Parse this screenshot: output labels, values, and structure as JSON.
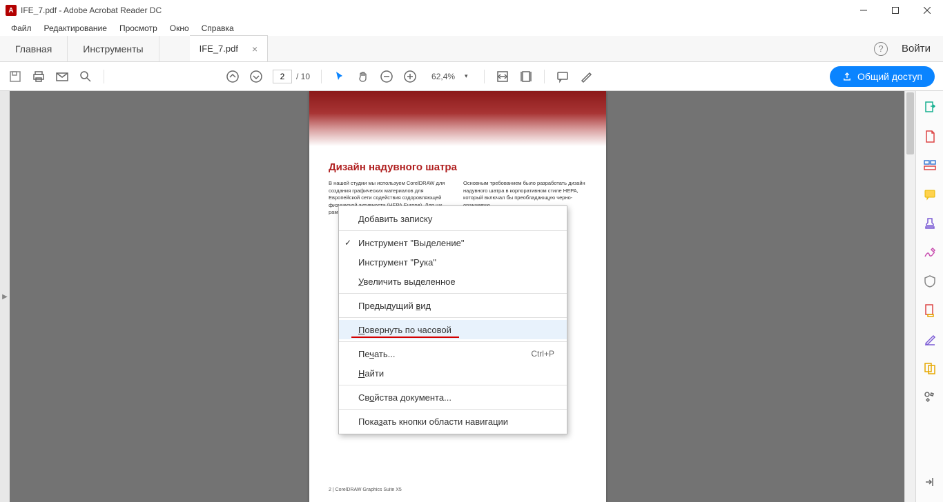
{
  "window": {
    "title": "IFE_7.pdf - Adobe Acrobat Reader DC"
  },
  "menubar": [
    "Файл",
    "Редактирование",
    "Просмотр",
    "Окно",
    "Справка"
  ],
  "tabs": {
    "home": "Главная",
    "tools": "Инструменты",
    "doc": "IFE_7.pdf"
  },
  "signin": "Войти",
  "toolbar": {
    "page_current": "2",
    "page_total": "/ 10",
    "zoom": "62,4%",
    "share": "Общий доступ"
  },
  "document": {
    "heading": "Дизайн надувного шатра",
    "col1": "В нашей студии мы используем CorelDRAW для создания графических материалов для Европейской сети содействия оздоровляющей физической активности (HEPA Europe). Для шк\nрам\nсоз\nпла\nукр\nкар\nпоп\nдиз",
    "col2": "Основным требованием было разработать дизайн надувного шатра в корпоративном стиле HEPA, который включал бы преобладающую черно-оранжевую",
    "footer": "2 | CorelDRAW Graphics Suite X5"
  },
  "context_menu": {
    "items": [
      {
        "label": "Добавить записку",
        "ul": "Д"
      },
      {
        "label": "Инструмент \"Выделение\"",
        "checked": true
      },
      {
        "label": "Инструмент \"Рука\""
      },
      {
        "label": "Увеличить выделенное",
        "ul": "У"
      },
      {
        "label": "Предыдущий вид",
        "ul": "в"
      },
      {
        "label": "Повернуть по часовой",
        "ul": "П",
        "hover": true,
        "redline": true
      },
      {
        "label": "Печать...",
        "ul": "ч",
        "shortcut": "Ctrl+P"
      },
      {
        "label": "Найти",
        "ul": "Н"
      },
      {
        "label": "Свойства документа...",
        "ul": "о"
      },
      {
        "label": "Показать кнопки области навигации",
        "ul": "з"
      }
    ]
  },
  "right_tools": [
    "export-pdf",
    "create-pdf",
    "organize",
    "comment",
    "stamp",
    "sign",
    "protect",
    "compress",
    "edit",
    "more",
    "collapse"
  ]
}
